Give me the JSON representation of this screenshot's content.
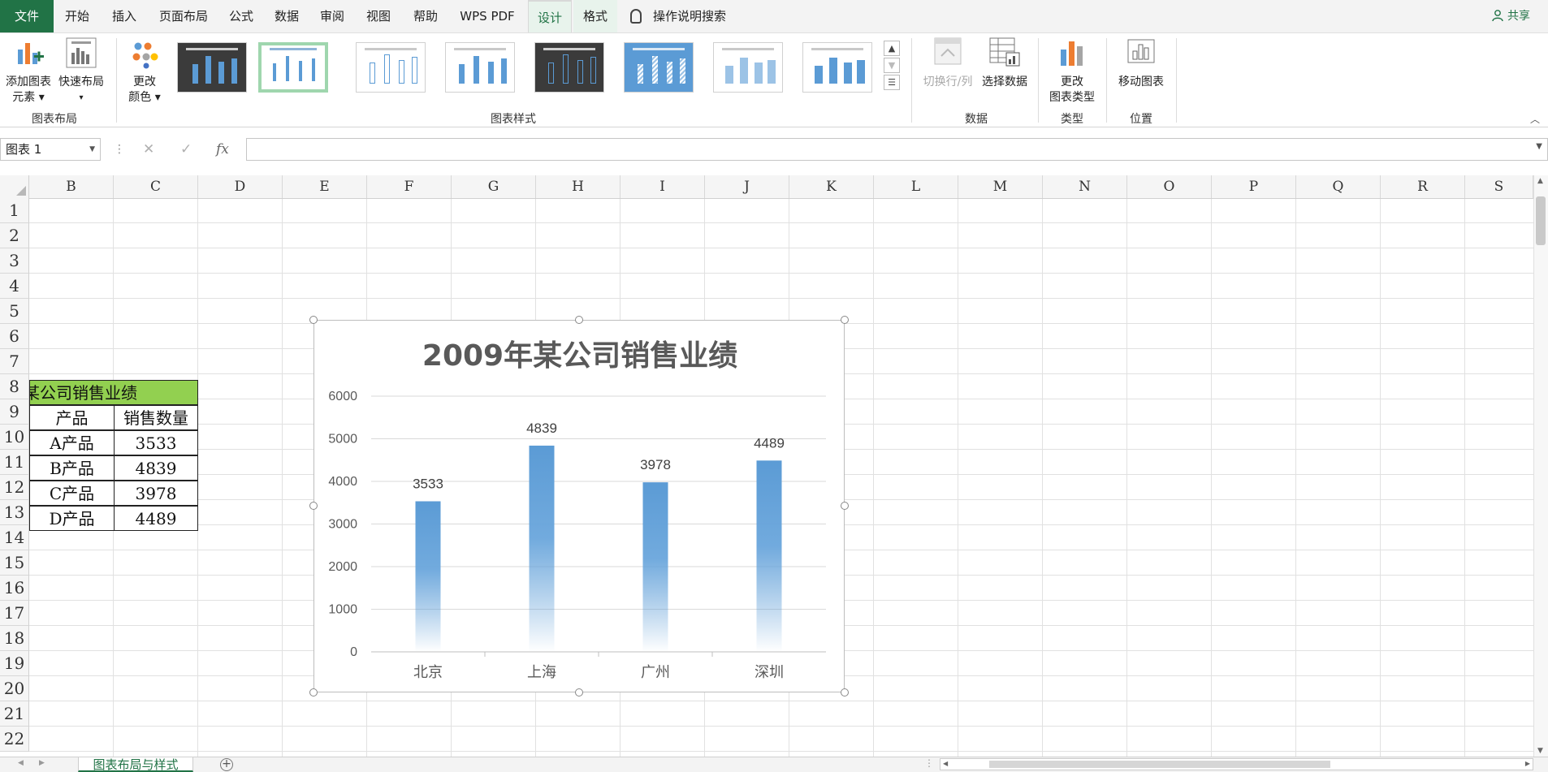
{
  "tabs": {
    "file": "文件",
    "items": [
      "开始",
      "插入",
      "页面布局",
      "公式",
      "数据",
      "审阅",
      "视图",
      "帮助",
      "WPS PDF",
      "设计",
      "格式"
    ],
    "active": "设计",
    "tell_me": "操作说明搜索",
    "share": "共享"
  },
  "ribbon": {
    "add_element": [
      "添加图表",
      "元素 ▾"
    ],
    "quick_layout": [
      "快速布局",
      "▾"
    ],
    "change_color": [
      "更改",
      "颜色 ▾"
    ],
    "switch_row_col": "切换行/列",
    "select_data": "选择数据",
    "change_type": [
      "更改",
      "图表类型"
    ],
    "move_chart": "移动图表",
    "groups": {
      "layout": "图表布局",
      "styles": "图表样式",
      "data": "数据",
      "type": "类型",
      "position": "位置"
    }
  },
  "formula_bar": {
    "name_box": "图表 1",
    "cancel_icon": "✕",
    "enter_icon": "✓",
    "fx": "fx",
    "formula": ""
  },
  "sheet": {
    "columns": [
      "B",
      "C",
      "D",
      "E",
      "F",
      "G",
      "H",
      "I",
      "J",
      "K",
      "L",
      "M",
      "N",
      "O",
      "P",
      "Q",
      "R",
      "S"
    ],
    "rows": [
      "1",
      "2",
      "3",
      "4",
      "5",
      "6",
      "7",
      "8",
      "9",
      "10",
      "11",
      "12",
      "13",
      "14",
      "15",
      "16",
      "17",
      "18",
      "19",
      "20",
      "21",
      "22"
    ],
    "table": {
      "title": "某公司销售业绩",
      "headers": [
        "产品",
        "销售数量"
      ],
      "rows": [
        [
          "A产品",
          "3533"
        ],
        [
          "B产品",
          "4839"
        ],
        [
          "C产品",
          "3978"
        ],
        [
          "D产品",
          "4489"
        ]
      ]
    }
  },
  "chart_data": {
    "type": "bar",
    "title": "2009年某公司销售业绩",
    "categories": [
      "北京",
      "上海",
      "广州",
      "深圳"
    ],
    "values": [
      3533,
      4839,
      3978,
      4489
    ],
    "data_labels": [
      "3533",
      "4839",
      "3978",
      "4489"
    ],
    "ylim": [
      0,
      6000
    ],
    "yticks": [
      "0",
      "1000",
      "2000",
      "3000",
      "4000",
      "5000",
      "6000"
    ],
    "xlabel": "",
    "ylabel": "",
    "grid": true,
    "bar_color": "#5b9bd5"
  },
  "bottom": {
    "sheet_tab": "图表布局与样式",
    "add_sheet": "+"
  }
}
